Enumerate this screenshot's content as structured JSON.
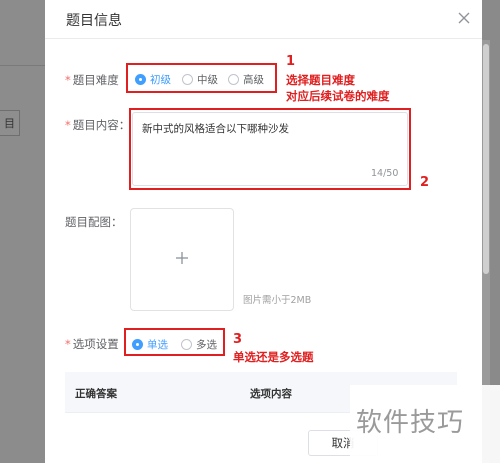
{
  "background": {
    "button_label": "目"
  },
  "dialog": {
    "title": "题目信息"
  },
  "difficulty": {
    "required_mark": "*",
    "label": "题目难度",
    "options": [
      "初级",
      "中级",
      "高级"
    ],
    "selected": "初级"
  },
  "content": {
    "required_mark": "*",
    "label": "题目内容：",
    "value": "新中式的风格适合以下哪种沙发",
    "counter": "14/50"
  },
  "image": {
    "label": "题目配图：",
    "tip": "图片需小于2MB"
  },
  "option_type": {
    "required_mark": "*",
    "label": "选项设置",
    "options": [
      "单选",
      "多选"
    ],
    "selected": "单选"
  },
  "table": {
    "columns": [
      "正确答案",
      "选项内容"
    ]
  },
  "footer": {
    "cancel_label": "取消"
  },
  "annotations": {
    "one": {
      "num": "1",
      "line1": "选择题目难度",
      "line2": "对应后续试卷的难度"
    },
    "two": {
      "num": "2"
    },
    "three": {
      "num": "3",
      "line1": "单选还是多选题"
    }
  },
  "watermark": "软件技巧",
  "colors": {
    "accent": "#409eff",
    "annotation": "#e02020",
    "overlay": "#8a8a8a"
  }
}
